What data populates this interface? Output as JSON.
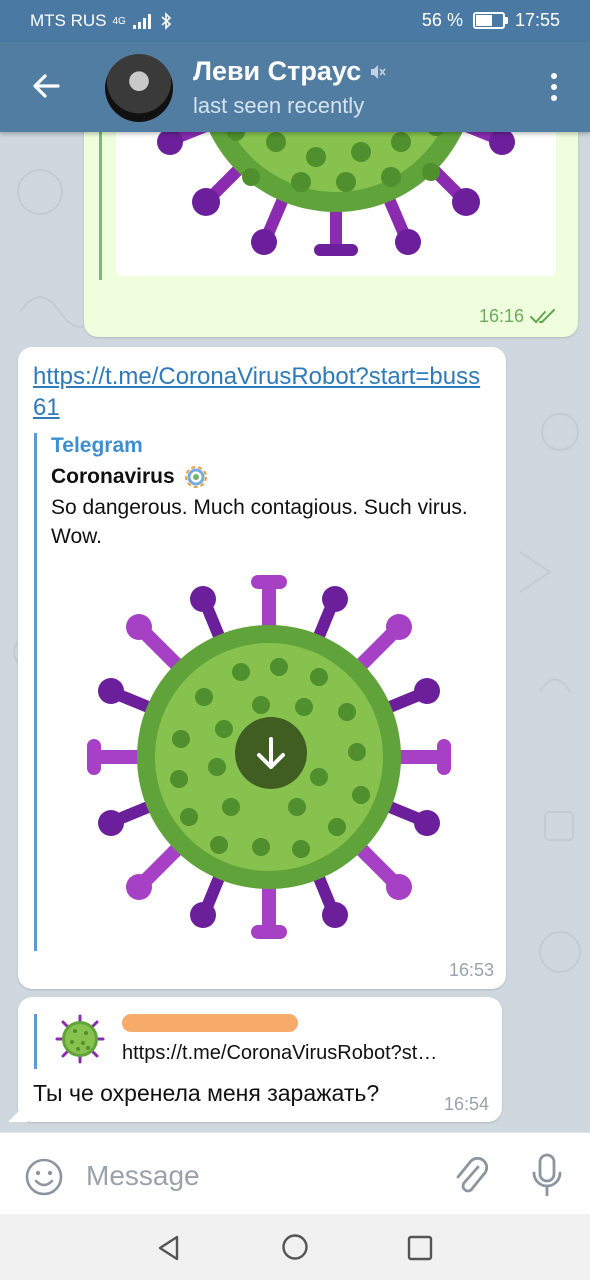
{
  "statusbar": {
    "carrier": "MTS RUS",
    "network": "4G",
    "battery": "56 %",
    "battery_level": 0.56,
    "time": "17:55"
  },
  "header": {
    "title": "Леви Страус",
    "subtitle": "last seen recently",
    "muted": true
  },
  "messages": {
    "outgoing": {
      "time": "16:16",
      "status": "read"
    },
    "link_message": {
      "url": "https://t.me/CoronaVirusRobot?start=buss61",
      "site_name": "Telegram",
      "preview_title": "Coronavirus",
      "preview_desc": "So dangerous. Much contagious. Such virus. Wow.",
      "time": "16:53"
    },
    "reply_message": {
      "quoted_text": "https://t.me/CoronaVirusRobot?st…",
      "text": "Ты че охренела меня заражать?",
      "time": "16:54"
    }
  },
  "composer": {
    "placeholder": "Message"
  },
  "colors": {
    "header": "#517da2",
    "status": "#4a7aa3",
    "link": "#2f7ab8",
    "virus_green": "#76b843",
    "virus_purple": "#8a2bb0"
  }
}
